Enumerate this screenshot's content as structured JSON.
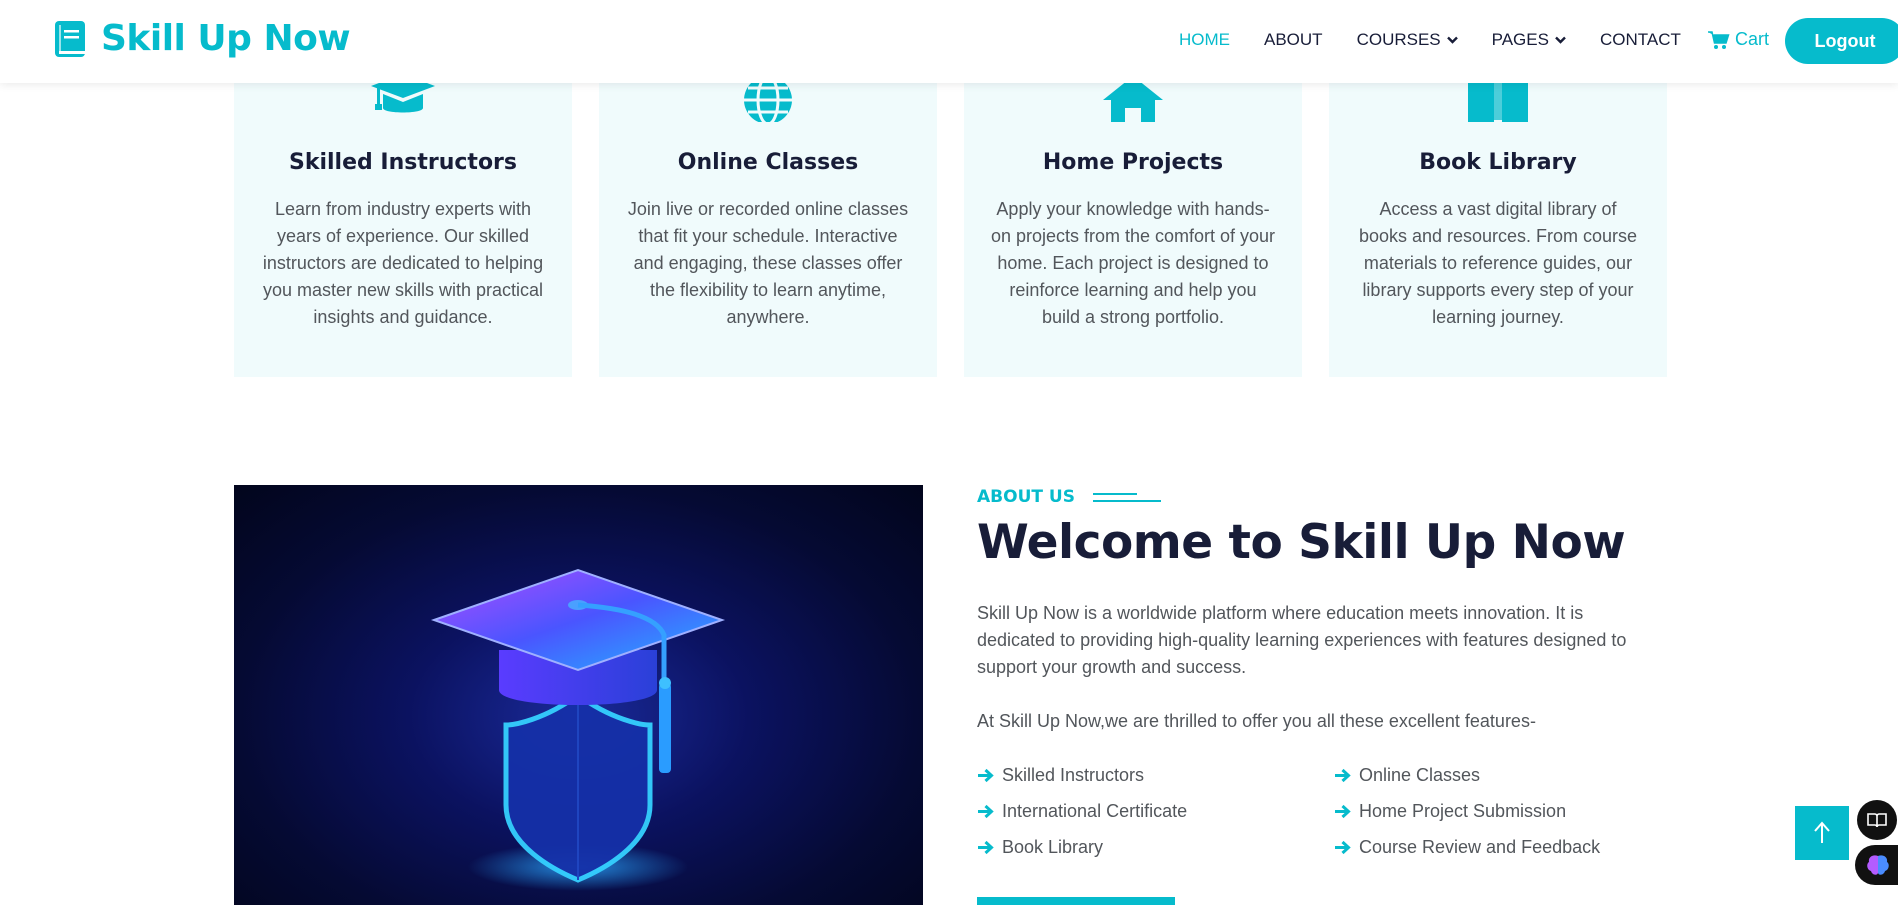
{
  "brand": {
    "name": "Skill Up Now",
    "icon": "book-icon",
    "color": "#06BBCC"
  },
  "nav": {
    "items": [
      {
        "label": "HOME",
        "active": true
      },
      {
        "label": "ABOUT",
        "active": false
      },
      {
        "label": "COURSES",
        "active": false,
        "dropdown": true
      },
      {
        "label": "PAGES",
        "active": false,
        "dropdown": true
      },
      {
        "label": "CONTACT",
        "active": false
      }
    ],
    "cart_label": "Cart",
    "logout_label": "Logout"
  },
  "services": [
    {
      "icon": "graduation-cap-icon",
      "title": "Skilled Instructors",
      "text": "Learn from industry experts with years of experience. Our skilled instructors are dedicated to helping you master new skills with practical insights and guidance."
    },
    {
      "icon": "globe-icon",
      "title": "Online Classes",
      "text": "Join live or recorded online classes that fit your schedule. Interactive and engaging, these classes offer the flexibility to learn anytime, anywhere."
    },
    {
      "icon": "home-icon",
      "title": "Home Projects",
      "text": "Apply your knowledge with hands-on projects from the comfort of your home. Each project is designed to reinforce learning and help you build a strong portfolio."
    },
    {
      "icon": "book-open-icon",
      "title": "Book Library",
      "text": "Access a vast digital library of books and resources. From course materials to reference guides, our library supports every step of your learning journey."
    }
  ],
  "about": {
    "tag": "ABOUT US",
    "title": "Welcome to Skill Up Now",
    "paragraph1": "Skill Up Now is a worldwide platform where education meets innovation. It is dedicated to providing high-quality learning experiences with features designed to support your growth and success.",
    "paragraph2": "At Skill Up Now,we are thrilled to offer you all these excellent features-",
    "features": [
      "Skilled Instructors",
      "Online Classes",
      "International Certificate",
      "Home Project Submission",
      "Book Library",
      "Course Review and Feedback"
    ]
  },
  "colors": {
    "primary": "#06BBCC",
    "dark": "#181d38",
    "card_bg": "#F0FBFC"
  }
}
